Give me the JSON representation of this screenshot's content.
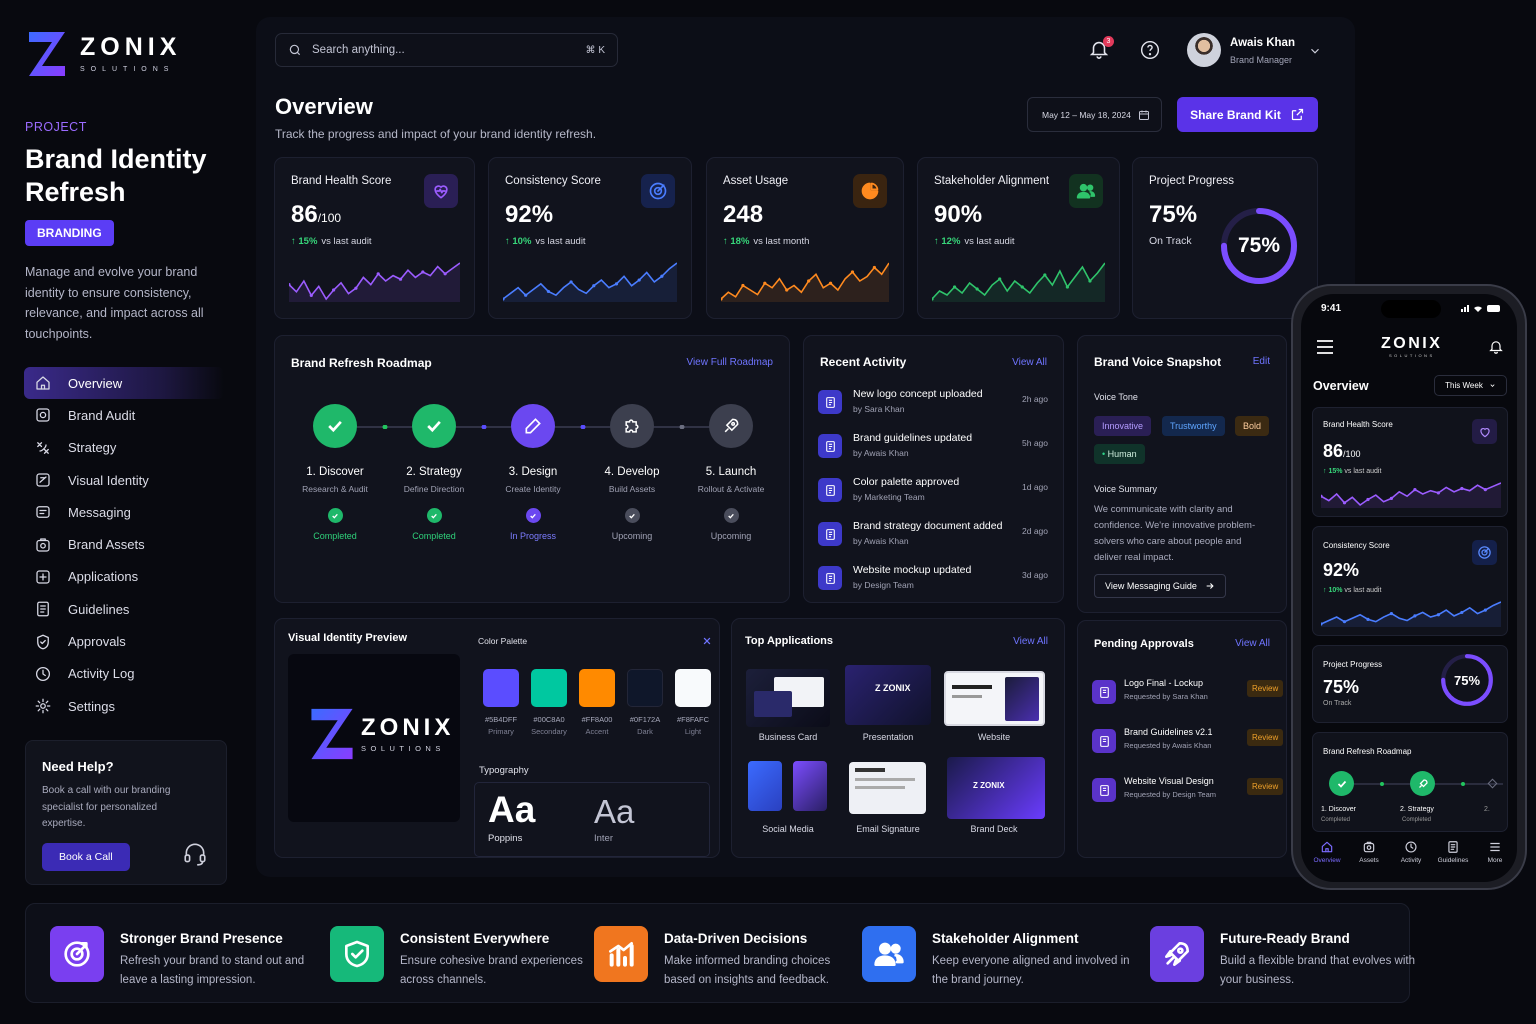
{
  "brand": {
    "name": "ZONIX",
    "tagline": "SOLUTIONS"
  },
  "project": {
    "label": "PROJECT",
    "title": "Brand Identity Refresh",
    "badge": "BRANDING",
    "description": "Manage and evolve your brand identity to ensure consistency, relevance, and impact across all touchpoints."
  },
  "nav": [
    {
      "label": "Overview",
      "icon": "home-icon",
      "active": true
    },
    {
      "label": "Brand Audit",
      "icon": "audit-icon"
    },
    {
      "label": "Strategy",
      "icon": "strategy-icon"
    },
    {
      "label": "Visual Identity",
      "icon": "visual-identity-icon"
    },
    {
      "label": "Messaging",
      "icon": "messaging-icon"
    },
    {
      "label": "Brand Assets",
      "icon": "brand-assets-icon"
    },
    {
      "label": "Applications",
      "icon": "applications-icon"
    },
    {
      "label": "Guidelines",
      "icon": "guidelines-icon"
    },
    {
      "label": "Approvals",
      "icon": "approvals-icon"
    },
    {
      "label": "Activity Log",
      "icon": "activity-log-icon"
    },
    {
      "label": "Settings",
      "icon": "gear-icon"
    }
  ],
  "help": {
    "title": "Need Help?",
    "text": "Book a call with our branding specialist for personalized expertise.",
    "button": "Book a Call"
  },
  "search": {
    "placeholder": "Search anything...",
    "shortcut": "⌘ K"
  },
  "notifications": {
    "count": "3"
  },
  "user": {
    "name": "Awais Khan",
    "role": "Brand Manager"
  },
  "overview": {
    "title": "Overview",
    "subtitle": "Track the progress and impact of your brand identity refresh.",
    "date_range": "May 12 – May 18, 2024",
    "share_label": "Share Brand Kit"
  },
  "kpis": [
    {
      "label": "Brand Health Score",
      "value": "86",
      "suffix": "/100",
      "delta": "15%",
      "compare": "vs last audit",
      "color": "#9b5cff",
      "icon": "heart-icon",
      "spark": [
        14,
        10,
        16,
        8,
        13,
        6,
        11,
        15,
        9,
        12,
        18,
        14,
        20,
        16,
        19,
        17,
        22,
        18,
        21,
        19,
        24,
        20,
        23,
        26
      ]
    },
    {
      "label": "Consistency Score",
      "value": "92%",
      "suffix": "",
      "delta": "10%",
      "compare": "vs last audit",
      "color": "#4a7dff",
      "icon": "target-icon",
      "spark": [
        6,
        9,
        12,
        8,
        11,
        14,
        10,
        8,
        12,
        15,
        11,
        9,
        13,
        16,
        12,
        14,
        18,
        13,
        16,
        20,
        15,
        18,
        22,
        25
      ]
    },
    {
      "label": "Asset Usage",
      "value": "248",
      "suffix": "",
      "delta": "18%",
      "compare": "vs last month",
      "color": "#ff8a1f",
      "icon": "pie-chart-icon",
      "spark": [
        5,
        8,
        6,
        11,
        9,
        7,
        12,
        10,
        14,
        9,
        11,
        8,
        13,
        16,
        10,
        12,
        9,
        14,
        17,
        13,
        15,
        19,
        16,
        21
      ]
    },
    {
      "label": "Stakeholder Alignment",
      "value": "90%",
      "suffix": "",
      "delta": "12%",
      "compare": "vs last audit",
      "color": "#2fc46b",
      "icon": "users-icon",
      "spark": [
        6,
        10,
        8,
        12,
        9,
        14,
        11,
        8,
        13,
        16,
        10,
        15,
        12,
        9,
        14,
        18,
        13,
        20,
        12,
        17,
        22,
        15,
        19,
        24
      ]
    }
  ],
  "progress": {
    "label": "Project Progress",
    "value": "75%",
    "status": "On Track",
    "percent": 75
  },
  "roadmap": {
    "title": "Brand Refresh Roadmap",
    "link": "View Full Roadmap",
    "steps": [
      {
        "name": "1. Discover",
        "sub": "Research & Audit",
        "status": "Completed",
        "state": "done"
      },
      {
        "name": "2. Strategy",
        "sub": "Define Direction",
        "status": "Completed",
        "state": "done"
      },
      {
        "name": "3. Design",
        "sub": "Create Identity",
        "status": "In Progress",
        "state": "progress"
      },
      {
        "name": "4. Develop",
        "sub": "Build Assets",
        "status": "Upcoming",
        "state": "upcoming"
      },
      {
        "name": "5. Launch",
        "sub": "Rollout & Activate",
        "status": "Upcoming",
        "state": "upcoming"
      }
    ]
  },
  "activity": {
    "title": "Recent Activity",
    "link": "View All",
    "items": [
      {
        "title": "New logo concept uploaded",
        "by": "by Sara Khan",
        "time": "2h ago"
      },
      {
        "title": "Brand guidelines updated",
        "by": "by Awais Khan",
        "time": "5h ago"
      },
      {
        "title": "Color palette approved",
        "by": "by Marketing Team",
        "time": "1d ago"
      },
      {
        "title": "Brand strategy document added",
        "by": "by Awais Khan",
        "time": "2d ago"
      },
      {
        "title": "Website mockup updated",
        "by": "by Design Team",
        "time": "3d ago"
      }
    ]
  },
  "voice": {
    "title": "Brand Voice Snapshot",
    "link": "Edit",
    "tone_label": "Voice Tone",
    "tags": [
      "Innovative",
      "Trustworthy",
      "Bold",
      "Human"
    ],
    "summary_label": "Voice Summary",
    "summary": "We communicate with clarity and confidence. We're innovative problem-solvers who care about people and deliver real impact.",
    "button": "View Messaging Guide"
  },
  "identity": {
    "title": "Visual Identity Preview",
    "palette_label": "Color Palette",
    "typography_label": "Typography",
    "colors": [
      {
        "hex": "#5B4DFF",
        "name": "Primary"
      },
      {
        "hex": "#00C8A0",
        "name": "Secondary"
      },
      {
        "hex": "#FF8A00",
        "name": "Accent"
      },
      {
        "hex": "#0F172A",
        "name": "Dark"
      },
      {
        "hex": "#F8FAFC",
        "name": "Light"
      }
    ],
    "fonts": [
      {
        "sample": "Aa",
        "name": "Poppins"
      },
      {
        "sample": "Aa",
        "name": "Inter"
      }
    ]
  },
  "applications": {
    "title": "Top Applications",
    "link": "View All",
    "items": [
      "Business Card",
      "Presentation",
      "Website",
      "Social Media",
      "Email Signature",
      "Brand Deck"
    ]
  },
  "approvals": {
    "title": "Pending Approvals",
    "link": "View All",
    "items": [
      {
        "title": "Logo Final - Lockup",
        "by": "Requested by Sara Khan",
        "status": "Review"
      },
      {
        "title": "Brand Guidelines v2.1",
        "by": "Requested by Awais Khan",
        "status": "Review"
      },
      {
        "title": "Website Visual Design",
        "by": "Requested by Design Team",
        "status": "Review"
      }
    ]
  },
  "features": [
    {
      "title": "Stronger Brand Presence",
      "text": "Refresh your brand to stand out and leave a lasting impression.",
      "color": "#7a3ff0",
      "icon": "target-arrow-icon"
    },
    {
      "title": "Consistent Everywhere",
      "text": "Ensure cohesive brand experiences across channels.",
      "color": "#16b97a",
      "icon": "shield-check-icon"
    },
    {
      "title": "Data-Driven Decisions",
      "text": "Make informed branding choices based on insights and feedback.",
      "color": "#f0761f",
      "icon": "bar-chart-icon"
    },
    {
      "title": "Stakeholder Alignment",
      "text": "Keep everyone aligned and involved in the brand journey.",
      "color": "#2f6ff0",
      "icon": "users-icon"
    },
    {
      "title": "Future-Ready Brand",
      "text": "Build a flexible brand that evolves with your business.",
      "color": "#6b3fe0",
      "icon": "rocket-icon"
    }
  ],
  "phone": {
    "time": "9:41",
    "brand": "ZONIX",
    "tagline": "SOLUTIONS",
    "title": "Overview",
    "filter": "This Week",
    "health_label": "Brand Health Score",
    "health_value": "86",
    "health_suffix": "/100",
    "health_delta": "15%",
    "health_compare": "vs last audit",
    "consistency_label": "Consistency Score",
    "consistency_value": "92%",
    "consistency_delta": "10%",
    "consistency_compare": "vs last audit",
    "progress_label": "Project Progress",
    "progress_value": "75%",
    "progress_status": "On Track",
    "progress_ring": "75%",
    "roadmap_label": "Brand Refresh Roadmap",
    "steps": [
      {
        "name": "1. Discover",
        "status": "Completed"
      },
      {
        "name": "2. Strategy",
        "status": "Completed"
      },
      {
        "name": "2."
      }
    ],
    "tabs": [
      "Overview",
      "Assets",
      "Activity",
      "Guidelines",
      "More"
    ]
  }
}
